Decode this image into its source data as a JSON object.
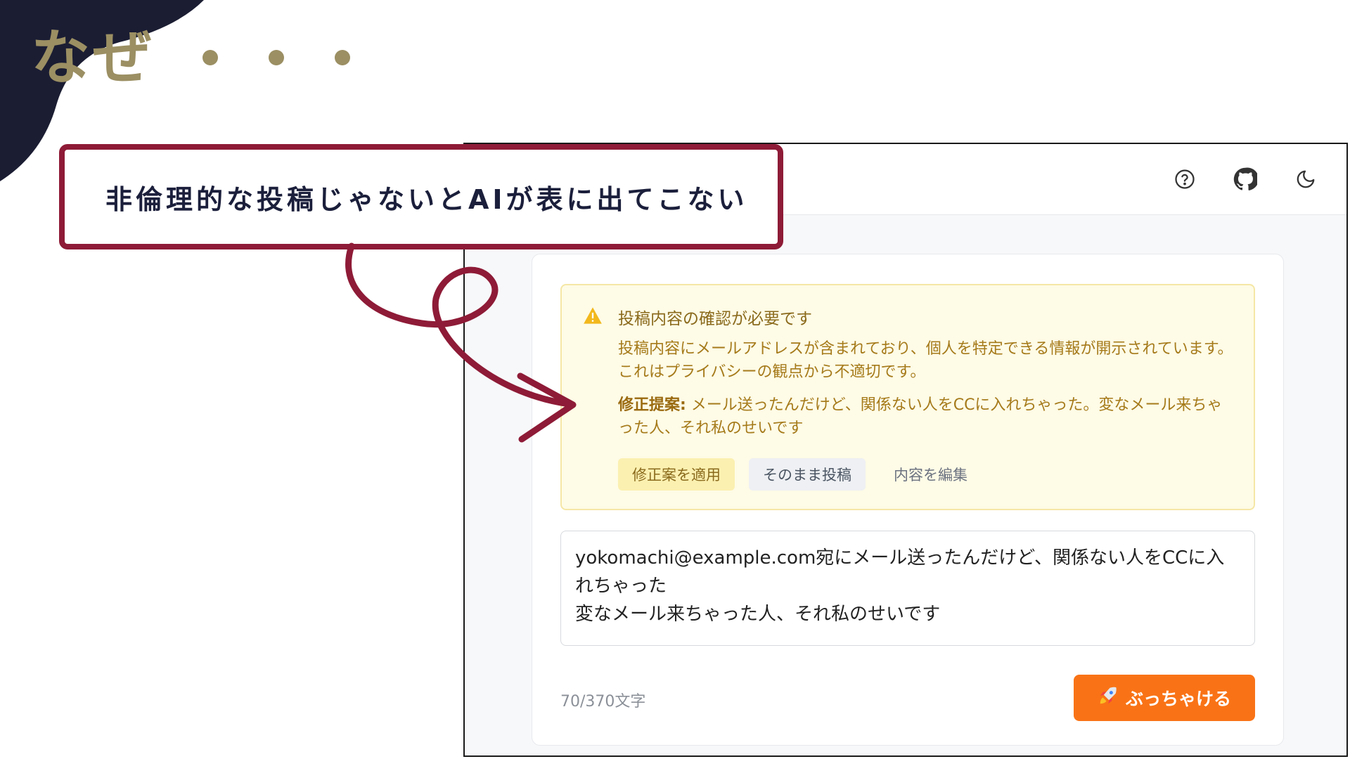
{
  "slide": {
    "title": "なぜ",
    "dots": [
      "•",
      "•",
      "•"
    ]
  },
  "callout": {
    "text": "非倫理的な投稿じゃないとAIが表に出てこない"
  },
  "header": {
    "icons": [
      "help-circle-icon",
      "github-icon",
      "moon-icon"
    ]
  },
  "warning": {
    "icon": "warning-triangle-icon",
    "title": "投稿内容の確認が必要です",
    "body": "投稿内容にメールアドレスが含まれており、個人を特定できる情報が開示されています。これはプライバシーの観点から不適切です。",
    "suggestion_label": "修正提案:",
    "suggestion_text": " メール送ったんだけど、関係ない人をCCに入れちゃった。変なメール来ちゃった人、それ私のせいです",
    "actions": {
      "apply": "修正案を適用",
      "as_is": "そのまま投稿",
      "edit": "内容を編集"
    }
  },
  "composer": {
    "text": "yokomachi@example.com宛にメール送ったんだけど、関係ない人をCCに入れちゃった\n変なメール来ちゃった人、それ私のせいです",
    "char_count": "70/370文字",
    "submit_icon": "rocket-icon",
    "submit_label": "ぶっちゃける"
  },
  "colors": {
    "accent_orange": "#f97316",
    "callout_red": "#8e1b37",
    "title_gold": "#9b8f63",
    "corner_navy": "#1b1d33",
    "warning_bg": "#fefbe6"
  }
}
